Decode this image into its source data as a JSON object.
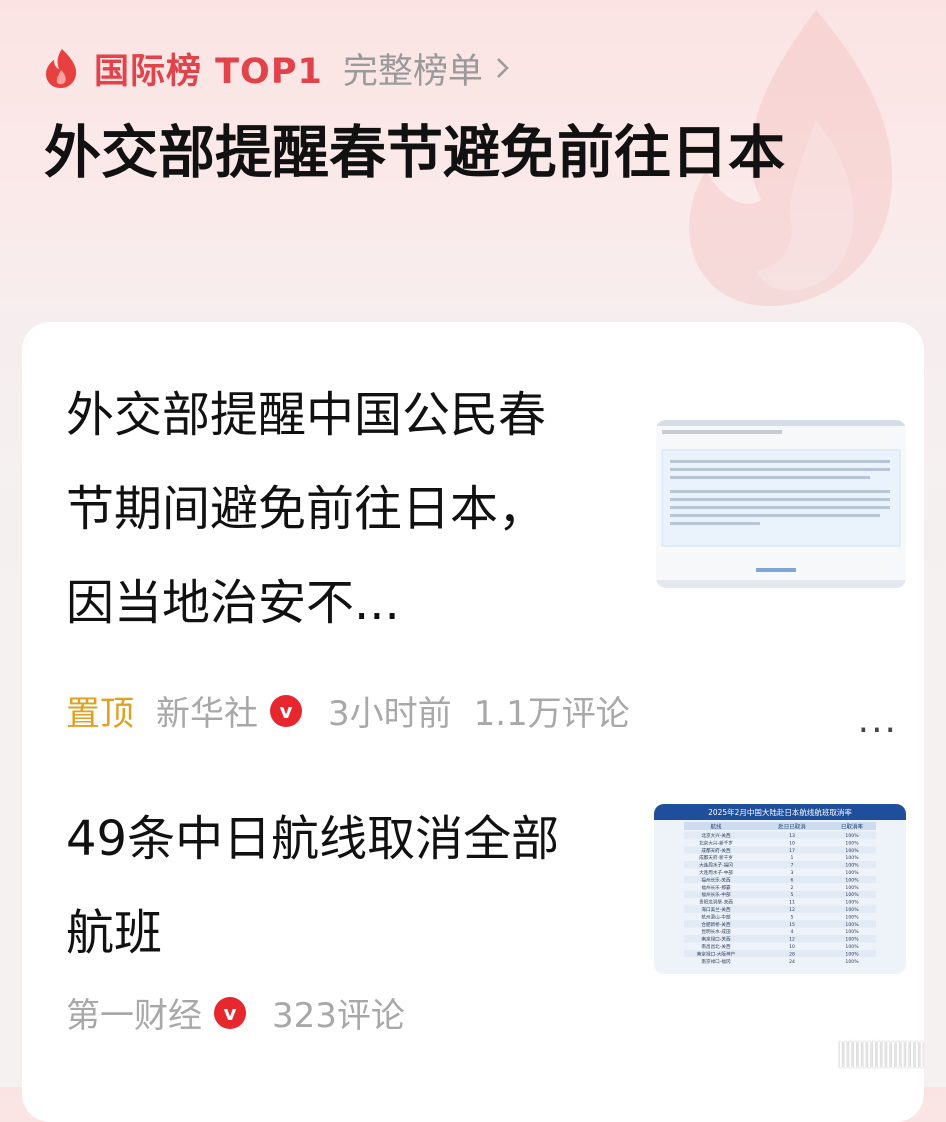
{
  "header": {
    "rank_label": "国际榜 TOP1",
    "full_list_label": "完整榜单",
    "topic_title": "外交部提醒春节避免前往日本"
  },
  "items": [
    {
      "title": "外交部提醒中国公民春节期间避免前往日本，因当地治安不...",
      "pin_label": "置顶",
      "source": "新华社",
      "verified_mark": "v",
      "time": "3小时前",
      "comments": "1.1万评论",
      "more_label": "···"
    },
    {
      "title": "49条中日航线取消全部航班",
      "source": "第一财经",
      "verified_mark": "v",
      "comments": "323评论"
    }
  ],
  "thumb2": {
    "caption": "2025年2月中国大陆赴日本航线航班取消率",
    "headers": [
      "航线",
      "赴日已取消",
      "已取消率"
    ],
    "rows": [
      [
        "北京大兴-关西",
        "13",
        "100%"
      ],
      [
        "北京大兴-新千岁",
        "10",
        "100%"
      ],
      [
        "成都天府-关西",
        "17",
        "100%"
      ],
      [
        "成都天府-新千岁",
        "1",
        "100%"
      ],
      [
        "大连周水子-福冈",
        "7",
        "100%"
      ],
      [
        "大连周水子-中部",
        "3",
        "100%"
      ],
      [
        "福州长乐-关西",
        "6",
        "100%"
      ],
      [
        "福州长乐-那霸",
        "2",
        "100%"
      ],
      [
        "福州长乐-中部",
        "5",
        "100%"
      ],
      [
        "贵阳龙洞堡-关西",
        "11",
        "100%"
      ],
      [
        "海口美兰-关西",
        "12",
        "100%"
      ],
      [
        "杭州萧山-中部",
        "5",
        "100%"
      ],
      [
        "合肥新桥-关西",
        "15",
        "100%"
      ],
      [
        "昆明长水-成田",
        "4",
        "100%"
      ],
      [
        "南京禄口-关西",
        "12",
        "100%"
      ],
      [
        "南昌昌北-关西",
        "10",
        "100%"
      ],
      [
        "南京禄口-大阪神户",
        "28",
        "100%"
      ],
      [
        "南京禄口-福冈",
        "24",
        "100%"
      ]
    ]
  },
  "colors": {
    "accent_red": "#e2434b",
    "pin_orange": "#e0a024",
    "badge_red": "#e8262d",
    "table_header_blue": "#1f4e9c"
  }
}
